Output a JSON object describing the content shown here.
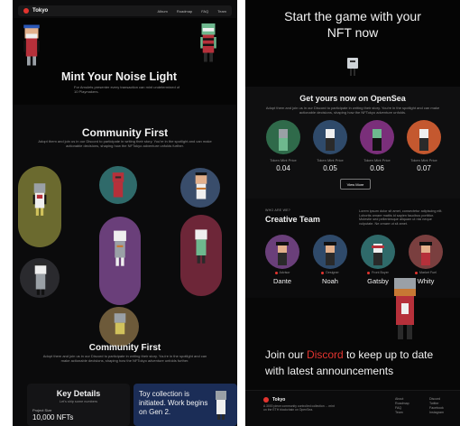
{
  "left_page": {
    "nav": {
      "brand": "Tokyo",
      "links": [
        "Album",
        "Roadmap",
        "FAQ",
        "Team"
      ]
    },
    "hero": {
      "title": "Mint Your Noise Light",
      "subtitle": "For Amulets presenter every transaction can mint undetermined of 10 Playmakers."
    },
    "community": {
      "title_1": "Community First",
      "desc_1": "Adopt them and join us in our Discord to participate in writing their story. You're in the spotlight and can make actionable decisions, shaping how the NFTokyo adventure unfolds further.",
      "title_2": "Community First",
      "desc_2": "Adopt them and join us in our Discord to participate in writing their story. You're in the spotlight and can make actionable decisions, shaping how the NFTokyo adventure unfolds further."
    },
    "key_details": {
      "title": "Key Details",
      "subtitle": "Let's ship some numbers",
      "label": "Project Size",
      "value": "10,000 NFTs"
    },
    "toy_card": {
      "text": "Toy collection is initiated. Work begins on Gen 2."
    }
  },
  "right_page": {
    "hero": {
      "title_line_1": "Start the game with your",
      "title_line_2": "NFT now"
    },
    "opensea": {
      "title": "Get yours now on OpenSea",
      "desc": "Adopt them and join us in our Discord to participate in writing their story. You're in the spotlight and can make actionable decisions, shaping how the NFTokyo adventure unfolds.",
      "items": [
        {
          "name": "Token Mint Price",
          "price": "0.04"
        },
        {
          "name": "Token Mint Price",
          "price": "0.05"
        },
        {
          "name": "Token Mint Price",
          "price": "0.06"
        },
        {
          "name": "Token Mint Price",
          "price": "0.07"
        }
      ],
      "view_more": "View More"
    },
    "team": {
      "eyebrow": "WHO ARE WE?",
      "title": "Creative Team",
      "desc": "Lorem ipsum dolor sit amet, consectetur adipiscing elit. Lobortis ornare mattis id sapien faucibus porttitor. Molestie sed pellentesque aliquam ut nisi neque vulputate. Ne ornare ut sit amet.",
      "members": [
        {
          "role": "Advisor",
          "name": "Dante"
        },
        {
          "role": "Designer",
          "name": "Noah"
        },
        {
          "role": "Front Buyer",
          "name": "Gatsby"
        },
        {
          "role": "Market Fuel",
          "name": "Whity"
        }
      ]
    },
    "cta": {
      "prefix": "Join our ",
      "highlight": "Discord",
      "suffix": " to keep up to date with latest announcements"
    },
    "footer": {
      "brand": "Tokyo",
      "desc": "A 3000 piece community controlled collection ... mint on the ETH blockchain on OpenSea.",
      "col1": [
        "About",
        "Roadmap",
        "FAQ",
        "Team"
      ],
      "col2": [
        "Discord",
        "Twitter",
        "Facebook",
        "Instagram"
      ]
    }
  },
  "colors": {
    "accent": "#e3342f",
    "blue_card": "#1b2d57"
  }
}
